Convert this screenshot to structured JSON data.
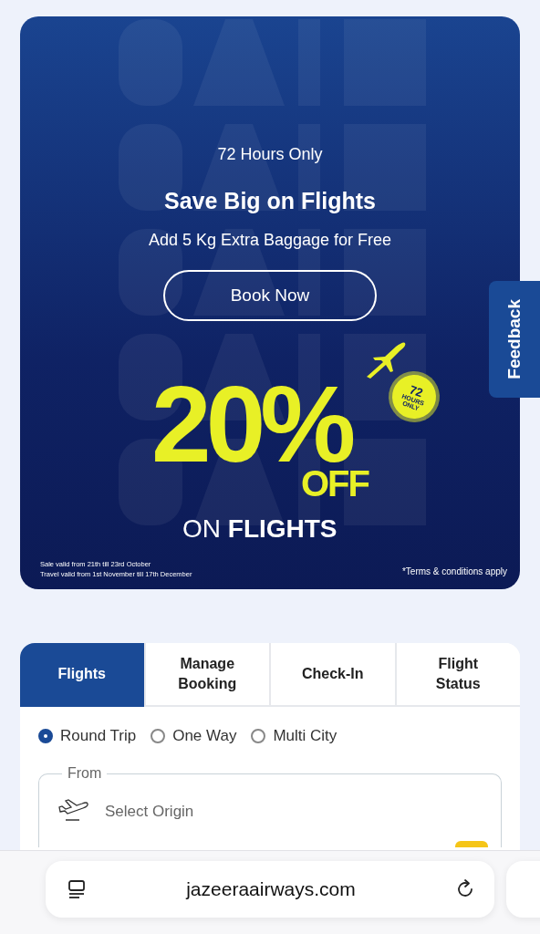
{
  "banner": {
    "backdrop": {
      "kind": "picture"
    },
    "eyebrow": "72 Hours Only",
    "headline": "Save Big on Flights",
    "subline": "Add 5 Kg Extra Baggage for Free",
    "cta": "Book Now",
    "discount": "20%",
    "off": "OFF",
    "on_flights": "ON **FLIGHTS**",
    "badge_lines": [
      "72",
      "HOURS",
      "ONLY"
    ],
    "fine_print": [
      "Sale valid from 21th till 23rd October",
      "Travel valid from 1st November till 17th December"
    ],
    "terms": "*Terms & conditions apply"
  },
  "feedback_tab": {
    "label": "Feedback"
  },
  "booking": {
    "tabs": [
      {
        "label": "Flights",
        "selected": true
      },
      {
        "label": "Manage Booking",
        "selected": false
      },
      {
        "label": "Check-In",
        "selected": false
      },
      {
        "label": "Flight Status",
        "selected": false
      }
    ],
    "trip_types": [
      {
        "label": "Round Trip",
        "selected": true
      },
      {
        "label": "One Way",
        "selected": false
      },
      {
        "label": "Multi City",
        "selected": false
      }
    ],
    "from_field": {
      "label": "From",
      "placeholder": "Select Origin"
    }
  },
  "browser_bar": {
    "url": "jazeeraairways.com"
  }
}
